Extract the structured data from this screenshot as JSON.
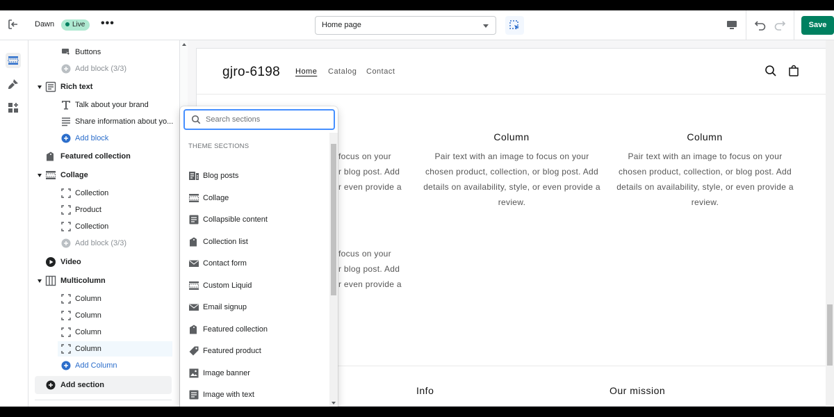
{
  "topbar": {
    "theme_name": "Dawn",
    "status_badge": "Live",
    "page_select_value": "Home page",
    "save_label": "Save"
  },
  "tree": {
    "rows": [
      {
        "label": "Buttons",
        "icon": "buttons-icon",
        "level": "child"
      },
      {
        "label": "Add block (3/3)",
        "icon": "add-circle-icon",
        "level": "child",
        "state": "disabled"
      },
      {
        "label": "Rich text",
        "icon": "rich-text-icon",
        "level": "section",
        "expanded": true
      },
      {
        "label": "Talk about your brand",
        "icon": "text-icon",
        "level": "child"
      },
      {
        "label": "Share information about yo...",
        "icon": "paragraph-icon",
        "level": "child"
      },
      {
        "label": "Add block",
        "icon": "add-circle-icon",
        "level": "child",
        "state": "link"
      },
      {
        "label": "Featured collection",
        "icon": "collection-icon",
        "level": "section"
      },
      {
        "label": "Collage",
        "icon": "collage-icon",
        "level": "section",
        "expanded": true
      },
      {
        "label": "Collection",
        "icon": "block-icon",
        "level": "child"
      },
      {
        "label": "Product",
        "icon": "block-icon",
        "level": "child"
      },
      {
        "label": "Collection",
        "icon": "block-icon",
        "level": "child"
      },
      {
        "label": "Add block (3/3)",
        "icon": "add-circle-icon",
        "level": "child",
        "state": "disabled"
      },
      {
        "label": "Video",
        "icon": "play-icon",
        "level": "section"
      },
      {
        "label": "Multicolumn",
        "icon": "multicolumn-icon",
        "level": "section",
        "expanded": true
      },
      {
        "label": "Column",
        "icon": "block-icon",
        "level": "child"
      },
      {
        "label": "Column",
        "icon": "block-icon",
        "level": "child"
      },
      {
        "label": "Column",
        "icon": "block-icon",
        "level": "child"
      },
      {
        "label": "Column",
        "icon": "block-icon",
        "level": "child",
        "state": "selected"
      },
      {
        "label": "Add Column",
        "icon": "add-circle-icon",
        "level": "child",
        "state": "link"
      },
      {
        "label": "Add section",
        "icon": "add-circle-icon",
        "level": "section",
        "state": "active"
      }
    ]
  },
  "popover": {
    "search_placeholder": "Search sections",
    "heading": "THEME SECTIONS",
    "items": [
      {
        "label": "Blog posts",
        "icon": "blog-icon"
      },
      {
        "label": "Collage",
        "icon": "collage-icon"
      },
      {
        "label": "Collapsible content",
        "icon": "collapsible-icon"
      },
      {
        "label": "Collection list",
        "icon": "collection-icon"
      },
      {
        "label": "Contact form",
        "icon": "envelope-icon"
      },
      {
        "label": "Custom Liquid",
        "icon": "custom-liquid-icon"
      },
      {
        "label": "Email signup",
        "icon": "envelope-icon"
      },
      {
        "label": "Featured collection",
        "icon": "collection-icon"
      },
      {
        "label": "Featured product",
        "icon": "tag-icon"
      },
      {
        "label": "Image banner",
        "icon": "image-icon"
      },
      {
        "label": "Image with text",
        "icon": "image-text-icon"
      }
    ]
  },
  "preview": {
    "store_name": "gjro-6198",
    "nav": [
      "Home",
      "Catalog",
      "Contact"
    ],
    "column_title": "Column",
    "column_text": "Pair text with an image to focus on your chosen product, collection, or blog post. Add details on availability, style, or even provide a review.",
    "partial_col1": [
      "focus on your",
      "r blog post. Add",
      "r even provide a"
    ],
    "partial_col2": [
      "focus on your",
      "r blog post. Add",
      "r even provide a"
    ],
    "footer_headings": [
      "Info",
      "Our mission"
    ]
  }
}
